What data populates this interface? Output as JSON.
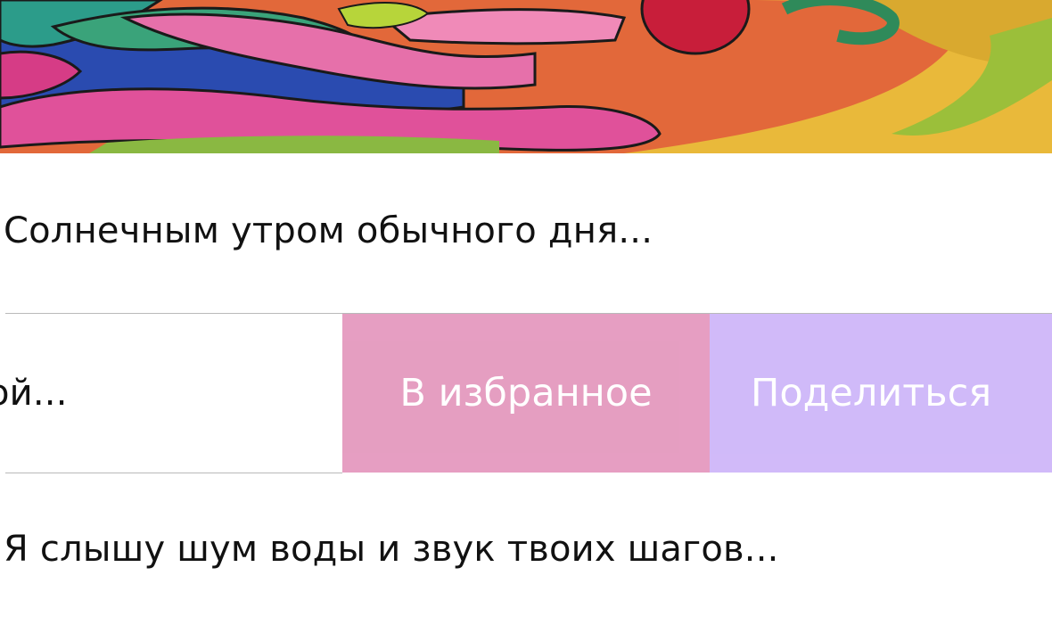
{
  "artwork": {
    "icon": "colorful-artwork-image"
  },
  "list": {
    "items": [
      {
        "title": "Солнечным утром обычного дня...",
        "selected": true
      },
      {
        "title": "ой..."
      },
      {
        "title": "Я слышу шум воды и звук твоих шагов..."
      }
    ],
    "actions": {
      "favorite_label": "В избранное",
      "share_label": "Поделиться"
    }
  },
  "colors": {
    "accent": "#3d7bf0",
    "favorite_bg": "#e59bc0",
    "share_bg": "#cfb8f9",
    "divider": "#b9b9b9"
  }
}
